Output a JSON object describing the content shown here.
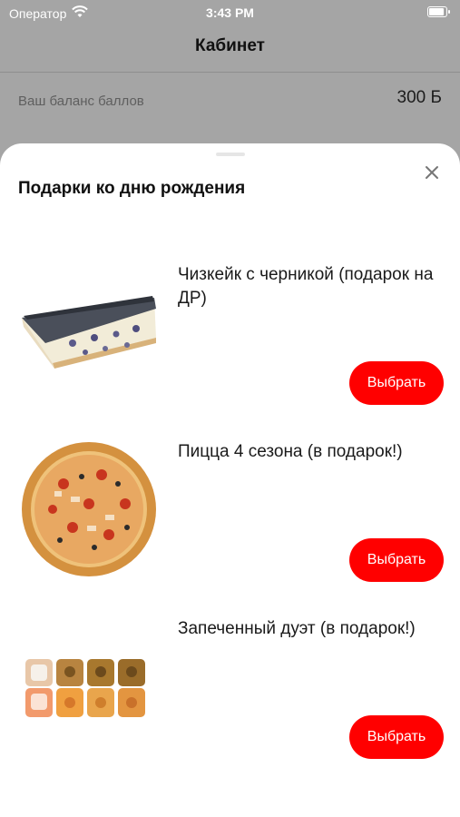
{
  "status_bar": {
    "carrier": "Оператор",
    "time": "3:43 PM",
    "battery_level": 0.92
  },
  "nav": {
    "title": "Кабинет"
  },
  "balance": {
    "label": "Ваш баланс баллов",
    "value": "300 Б"
  },
  "sheet": {
    "title": "Подарки ко дню рождения",
    "close_icon": "close-icon",
    "gifts": [
      {
        "name": "Чизкейк с черникой (подарок на ДР)",
        "button_label": "Выбрать",
        "image": "cheesecake-image"
      },
      {
        "name": "Пицца 4 сезона (в подарок!)",
        "button_label": "Выбрать",
        "image": "pizza-image"
      },
      {
        "name": "Запеченный дуэт (в подарок!)",
        "button_label": "Выбрать",
        "image": "sushi-rolls-image"
      }
    ]
  },
  "colors": {
    "accent": "#ff0000",
    "overlay_bg": "#a5a5a5",
    "sheet_bg": "#ffffff"
  }
}
